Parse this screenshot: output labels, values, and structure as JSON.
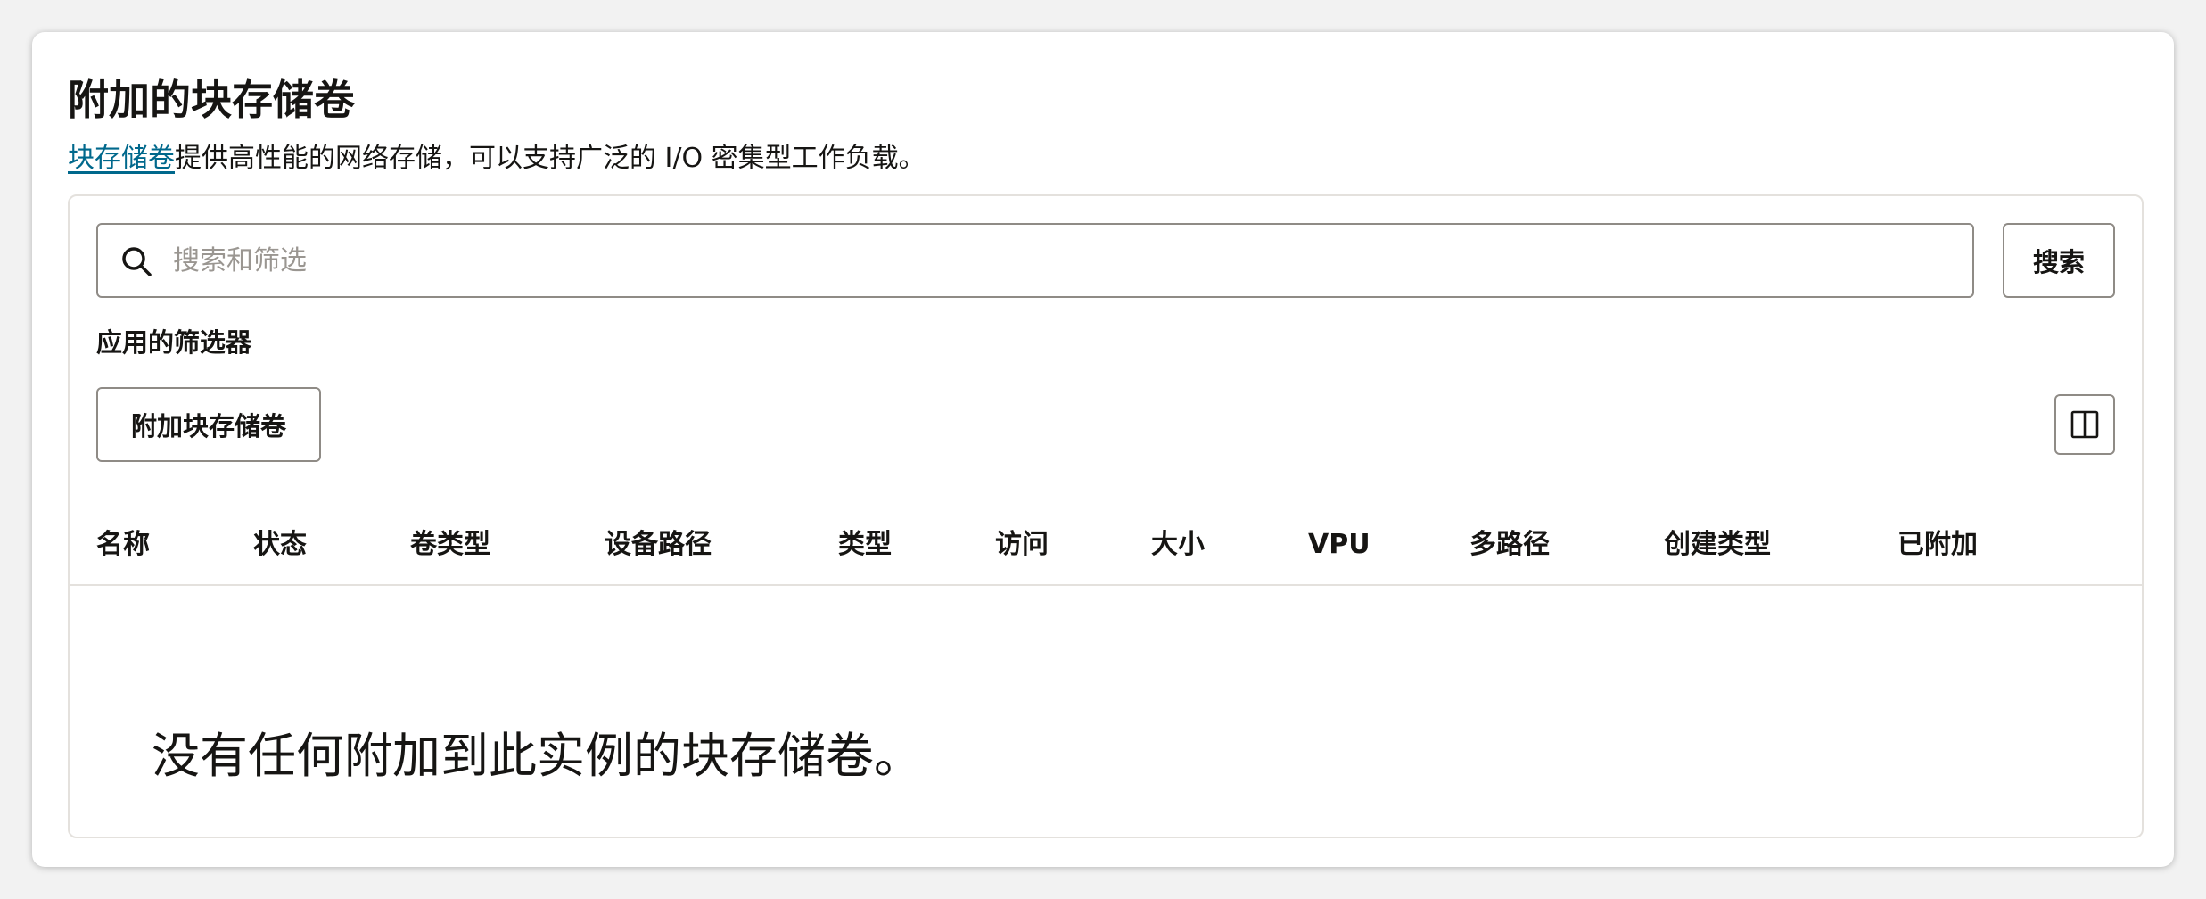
{
  "section": {
    "title": "附加的块存储卷",
    "description_link": "块存储卷",
    "description_text": "提供高性能的网络存储，可以支持广泛的 I/O 密集型工作负载。"
  },
  "search": {
    "placeholder": "搜索和筛选",
    "button_label": "搜索",
    "icon": "search-icon"
  },
  "filters": {
    "label": "应用的筛选器"
  },
  "toolbar": {
    "attach_label": "附加块存储卷",
    "columns_icon": "columns-icon"
  },
  "table": {
    "columns": [
      "名称",
      "状态",
      "卷类型",
      "设备路径",
      "类型",
      "访问",
      "大小",
      "VPU",
      "多路径",
      "创建类型",
      "已附加"
    ],
    "empty_message": "没有任何附加到此实例的块存储卷。"
  },
  "colors": {
    "link": "#00688c",
    "border": "#8f8b86",
    "divider": "#e4e1dd",
    "text": "#161513"
  }
}
